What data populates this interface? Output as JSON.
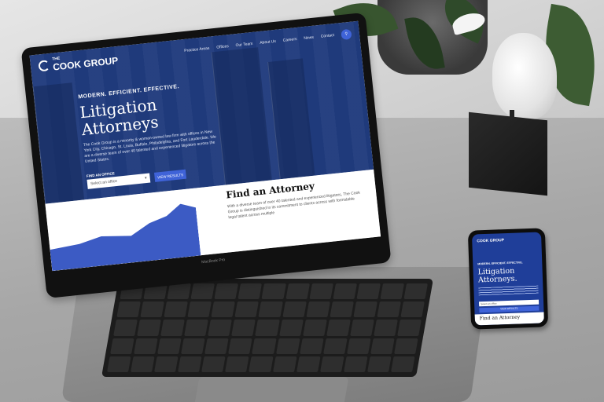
{
  "site": {
    "logo_small": "THE",
    "logo_text": "COOK GROUP",
    "nav": [
      "Practice Areas",
      "Offices",
      "Our Team",
      "About Us",
      "Careers",
      "News",
      "Contact"
    ],
    "search_icon": "search-icon",
    "tagline": "MODERN. EFFICIENT. EFFECTIVE.",
    "hero_title_line1": "Litigation",
    "hero_title_line2": "Attorneys",
    "hero_text": "The Cook Group is a minority & woman-owned law firm with offices in New York City, Chicago, St. Louis, Buffalo, Philadelphia, and Fort Lauderdale. We are a diverse team of over 40 talented and experienced litigators across the United States.",
    "find_office_label": "FIND AN OFFICE",
    "office_select_value": "Select an office",
    "view_results_button": "VIEW RESULTS",
    "find_title": "Find an Attorney",
    "find_text": "With a diverse team of over 40 talented and experienced litigators, The Cook Group is distinguished in its commitment to clients across with formidable legal talent across multiple",
    "device_brand": "MacBook Pro"
  },
  "phone": {
    "logo_text": "COOK GROUP",
    "tagline": "MODERN. EFFICIENT. EFFECTIVE.",
    "title_line1": "Litigation",
    "title_line2": "Attorneys.",
    "select_value": "Select an office",
    "button_label": "VIEW RESULTS",
    "find_title": "Find an Attorney"
  },
  "colors": {
    "brand_blue": "#1f3e99",
    "accent_blue": "#3f63d8"
  }
}
